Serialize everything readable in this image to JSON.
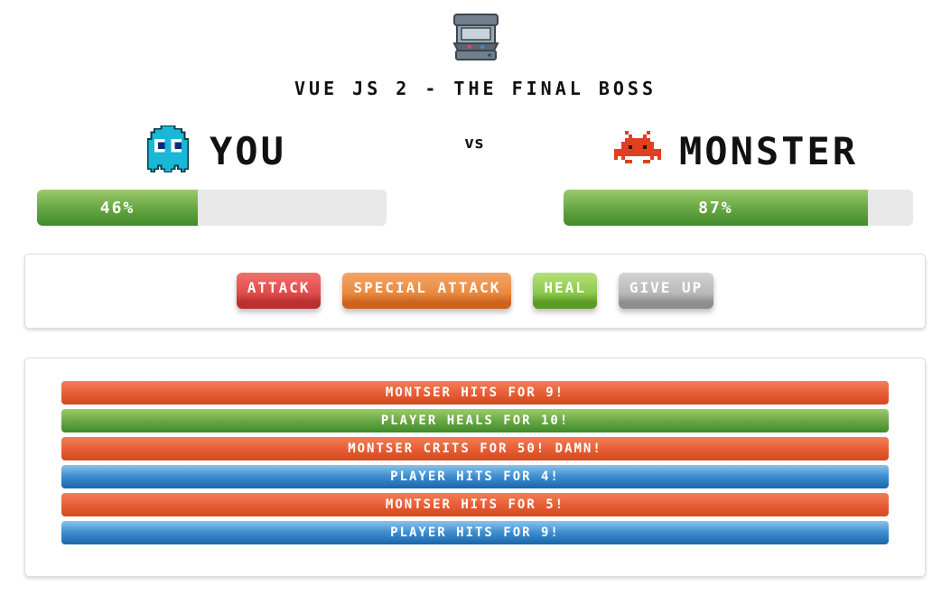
{
  "app": {
    "title": "VUE JS 2 - THE FINAL BOSS",
    "icon": "arcade-cabinet-icon"
  },
  "player": {
    "name": "YOU",
    "icon": "ghost-icon",
    "health_percent": 46,
    "health_label": "46%",
    "color": "#1ab7d6"
  },
  "versus_label": "vs",
  "monster": {
    "name": "MONSTER",
    "icon": "space-invader-icon",
    "health_percent": 87,
    "health_label": "87%",
    "color": "#e0401f"
  },
  "controls": {
    "attack_label": "ATTACK",
    "special_attack_label": "SPECIAL ATTACK",
    "heal_label": "HEAL",
    "give_up_label": "GIVE UP"
  },
  "log": [
    {
      "type": "monster",
      "text": "MONTSER HITS FOR 9!"
    },
    {
      "type": "heal",
      "text": "PLAYER HEALS FOR 10!"
    },
    {
      "type": "monster",
      "text": "MONTSER CRITS FOR 50! DAMN!"
    },
    {
      "type": "player",
      "text": "PLAYER HITS FOR 4!"
    },
    {
      "type": "monster",
      "text": "MONTSER HITS FOR 5!"
    },
    {
      "type": "player",
      "text": "PLAYER HITS FOR 9!"
    }
  ],
  "colors": {
    "health_green": "#6aa846",
    "attack_red": "#e04b4b",
    "special_orange": "#e98a3e",
    "heal_green": "#8cc84b",
    "give_up_gray": "#b8b8b8",
    "log_monster": "#e55a32",
    "log_player": "#3c8ccf"
  }
}
